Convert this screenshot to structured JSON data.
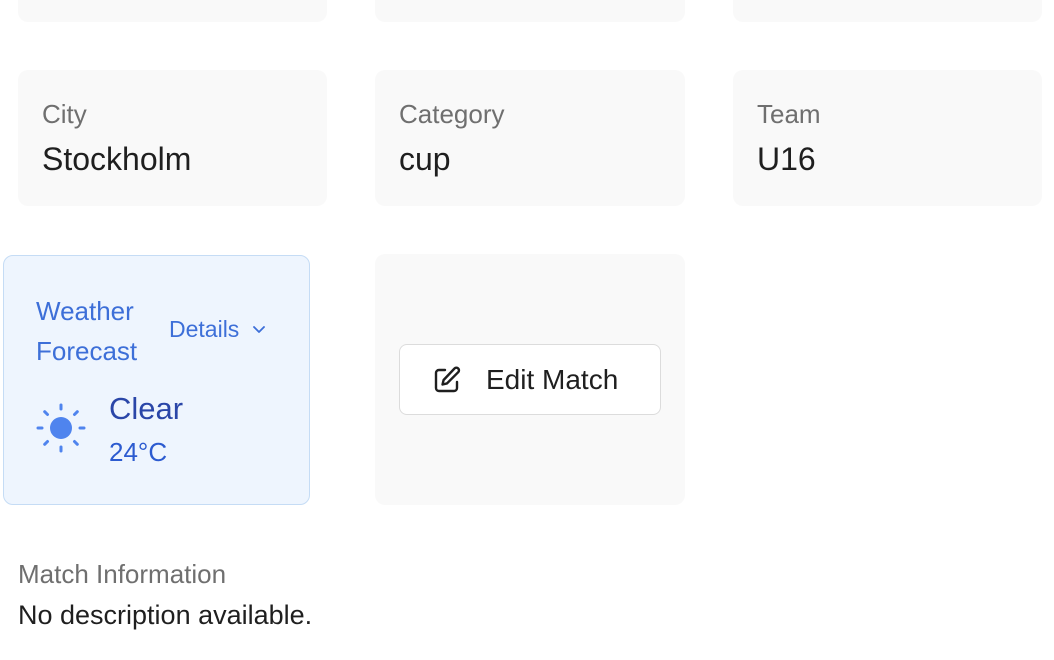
{
  "details_cards": [
    {
      "label": "City",
      "value": "Stockholm"
    },
    {
      "label": "Category",
      "value": "cup"
    },
    {
      "label": "Team",
      "value": "U16"
    }
  ],
  "weather": {
    "title": "Weather Forecast",
    "details_label": "Details",
    "condition": "Clear",
    "temperature": "24°C",
    "icon": "sun-icon",
    "accent_color": "#3d6fd8"
  },
  "actions": {
    "edit_label": "Edit Match",
    "edit_icon": "edit-icon"
  },
  "match_info": {
    "heading": "Match Information",
    "description": "No description available."
  }
}
